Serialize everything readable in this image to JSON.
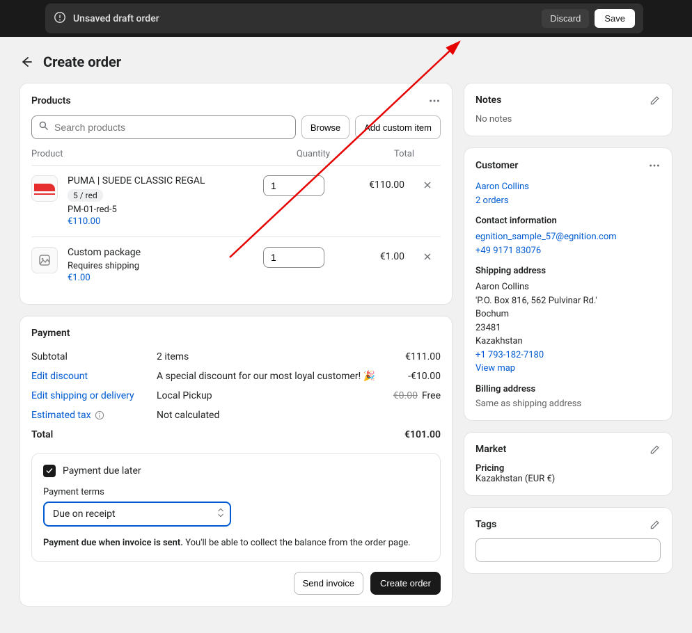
{
  "topbar": {
    "draft_label": "Unsaved draft order",
    "discard": "Discard",
    "save": "Save"
  },
  "header": {
    "title": "Create order"
  },
  "products": {
    "title": "Products",
    "search_placeholder": "Search products",
    "browse": "Browse",
    "add_custom": "Add custom item",
    "columns": {
      "product": "Product",
      "quantity": "Quantity",
      "total": "Total"
    },
    "items": [
      {
        "name": "PUMA | SUEDE CLASSIC REGAL",
        "variant": "5 / red",
        "sku": "PM-01-red-5",
        "price": "€110.00",
        "qty": "1",
        "total": "€110.00"
      },
      {
        "name": "Custom package",
        "note": "Requires shipping",
        "price": "€1.00",
        "qty": "1",
        "total": "€1.00"
      }
    ]
  },
  "payment": {
    "title": "Payment",
    "subtotal_label": "Subtotal",
    "subtotal_desc": "2 items",
    "subtotal_val": "€111.00",
    "discount_label": "Edit discount",
    "discount_desc": "A special discount for our most loyal customer! 🎉",
    "discount_val": "-€10.00",
    "shipping_label": "Edit shipping or delivery",
    "shipping_desc": "Local Pickup",
    "shipping_strike": "€0.00",
    "shipping_val": "Free",
    "tax_label": "Estimated tax",
    "tax_desc": "Not calculated",
    "total_label": "Total",
    "total_val": "€101.00",
    "due_later_label": "Payment due later",
    "terms_label": "Payment terms",
    "terms_value": "Due on receipt",
    "help_bold": "Payment due when invoice is sent.",
    "help_rest": " You'll be able to collect the balance from the order page.",
    "send_invoice": "Send invoice",
    "create_order": "Create order"
  },
  "notes": {
    "title": "Notes",
    "empty": "No notes"
  },
  "customer": {
    "title": "Customer",
    "name": "Aaron Collins",
    "orders": "2 orders",
    "contact_title": "Contact information",
    "email": "egnition_sample_57@egnition.com",
    "phone": "+49 9171 83076",
    "shipping_title": "Shipping address",
    "ship_name": "Aaron Collins",
    "ship_l1": "'P.O. Box 816, 562 Pulvinar Rd.'",
    "ship_city": "Bochum",
    "ship_zip": "23481",
    "ship_country": "Kazakhstan",
    "ship_phone": "+1 793-182-7180",
    "view_map": "View map",
    "billing_title": "Billing address",
    "billing_text": "Same as shipping address"
  },
  "market": {
    "title": "Market",
    "pricing_label": "Pricing",
    "pricing_value": "Kazakhstan (EUR €)"
  },
  "tags": {
    "title": "Tags"
  }
}
